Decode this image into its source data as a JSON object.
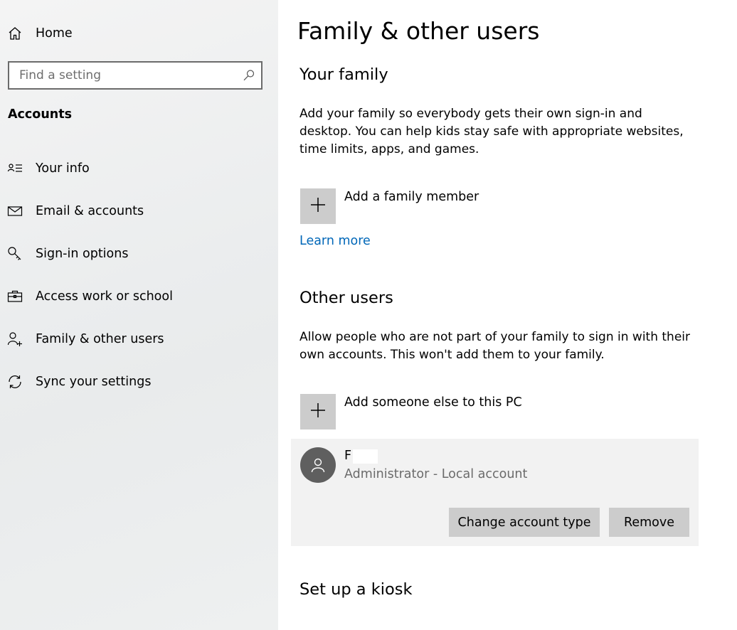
{
  "sidebar": {
    "home_label": "Home",
    "search_placeholder": "Find a setting",
    "section_title": "Accounts",
    "items": [
      {
        "label": "Your info",
        "icon": "contact-info-icon"
      },
      {
        "label": "Email & accounts",
        "icon": "mail-icon"
      },
      {
        "label": "Sign-in options",
        "icon": "key-icon"
      },
      {
        "label": "Access work or school",
        "icon": "briefcase-icon"
      },
      {
        "label": "Family & other users",
        "icon": "add-person-icon"
      },
      {
        "label": "Sync your settings",
        "icon": "sync-icon"
      }
    ]
  },
  "main": {
    "title": "Family & other users",
    "family": {
      "heading": "Your family",
      "description": "Add your family so everybody gets their own sign-in and desktop. You can help kids stay safe with appropriate websites, time limits, apps, and games.",
      "add_label": "Add a family member",
      "learn_more": "Learn more"
    },
    "other_users": {
      "heading": "Other users",
      "description": "Allow people who are not part of your family to sign in with their own accounts. This won't add them to your family.",
      "add_label": "Add someone else to this PC",
      "user": {
        "name": "F",
        "account_info": "Administrator - Local account",
        "change_button": "Change account type",
        "remove_button": "Remove"
      }
    },
    "kiosk": {
      "heading": "Set up a kiosk"
    }
  },
  "colors": {
    "accent_link": "#0067b8",
    "button_bg": "#cccccc",
    "card_bg": "#f2f2f2",
    "avatar_bg": "#5f5f5f"
  }
}
